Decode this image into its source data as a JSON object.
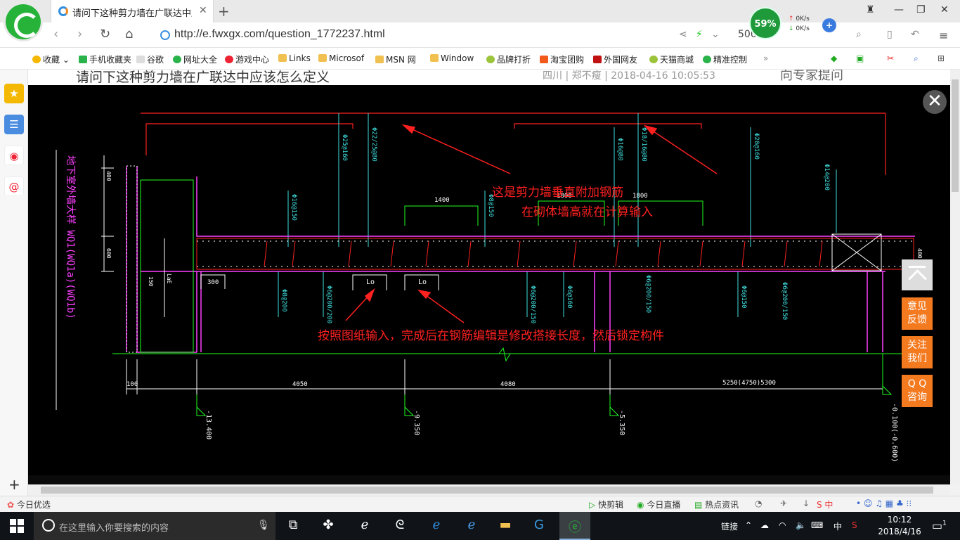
{
  "browser": {
    "tab_title": "请问下这种剪力墙在广联达中应该",
    "url": "http://e.fwxgx.com/question_1772237.html",
    "speed_percent": "59%",
    "upload_speed": "0K/s",
    "download_speed": "0K/s",
    "search_hint": "500"
  },
  "bookmarks": [
    "收藏",
    "手机收藏夹",
    "谷歌",
    "网址大全",
    "游戏中心",
    "Links",
    "Microsof",
    "MSN 网",
    "Window",
    "品牌打折",
    "淘宝团购",
    "外国网友",
    "天猫商城",
    "精准控制"
  ],
  "page": {
    "title": "请问下这种剪力墙在广联达中应该怎么定义",
    "location": "四川",
    "author": "郑不瘦",
    "datetime": "2018-04-16 10:05:53",
    "ask_expert": "向专家提问"
  },
  "drawing": {
    "annotation_1_line1": "这是剪力墙垂直附加钢筋",
    "annotation_1_line2": "在砌体墙高就在计算输入",
    "annotation_2": "按照图纸输入，完成后在钢筋编辑是修改搭接长度，然后锁定构件",
    "dims_bottom": [
      "100",
      "4050",
      "4080",
      "5250(4750)5300"
    ],
    "dims_top": [
      "1400",
      "1800",
      "1800"
    ],
    "dim_300": "300",
    "lap_labels": [
      "Lo",
      "Lo"
    ],
    "elevations": [
      "-13.400",
      "-9.350",
      "-5.350",
      "-0.100(-0.600)"
    ],
    "left_title": "地下室外墙大样 WQ1(WQ1a)(WQ1b)",
    "dim_left": [
      "400",
      "600",
      "150",
      "LaE",
      "400"
    ]
  },
  "float_buttons": {
    "feedback": [
      "意见",
      "反馈"
    ],
    "follow": [
      "关注",
      "我们"
    ],
    "qq": [
      "Q Q",
      "咨询"
    ]
  },
  "statusbar": {
    "left": "今日优选",
    "items": [
      "快剪辑",
      "今日直播",
      "热点资讯"
    ]
  },
  "taskbar": {
    "search_placeholder": "在这里输入你要搜索的内容",
    "link_label": "链接",
    "ime": "中",
    "time": "10:12",
    "date": "2018/4/16",
    "notifications": "1"
  }
}
